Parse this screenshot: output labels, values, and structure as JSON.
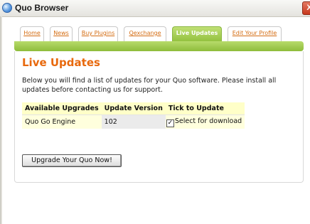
{
  "window": {
    "title": "Quo Browser",
    "close_glyph": "X"
  },
  "tabs": [
    {
      "label": "Home",
      "active": false
    },
    {
      "label": "News",
      "active": false
    },
    {
      "label": "Buy Plugins",
      "active": false
    },
    {
      "label": "Qexchange",
      "active": false
    },
    {
      "label": "Live Updates",
      "active": true
    },
    {
      "label": "Edit Your Profile",
      "active": false
    }
  ],
  "page": {
    "heading": "Live Updates",
    "description": "Below you will find a list of updates for your Quo software. Please install all updates before contacting us for support."
  },
  "table": {
    "headers": [
      "Available Upgrades",
      "Update Version",
      "Tick to Update"
    ],
    "rows": [
      {
        "name": "Quo Go Engine",
        "version": "102",
        "checked": true,
        "check_label": "Select for download"
      }
    ]
  },
  "button": {
    "label": "Upgrade Your Quo Now!"
  },
  "colors": {
    "accent_orange": "#e8690d",
    "tab_green": "#8fbe3a",
    "table_header_bg": "#ffffc8"
  }
}
